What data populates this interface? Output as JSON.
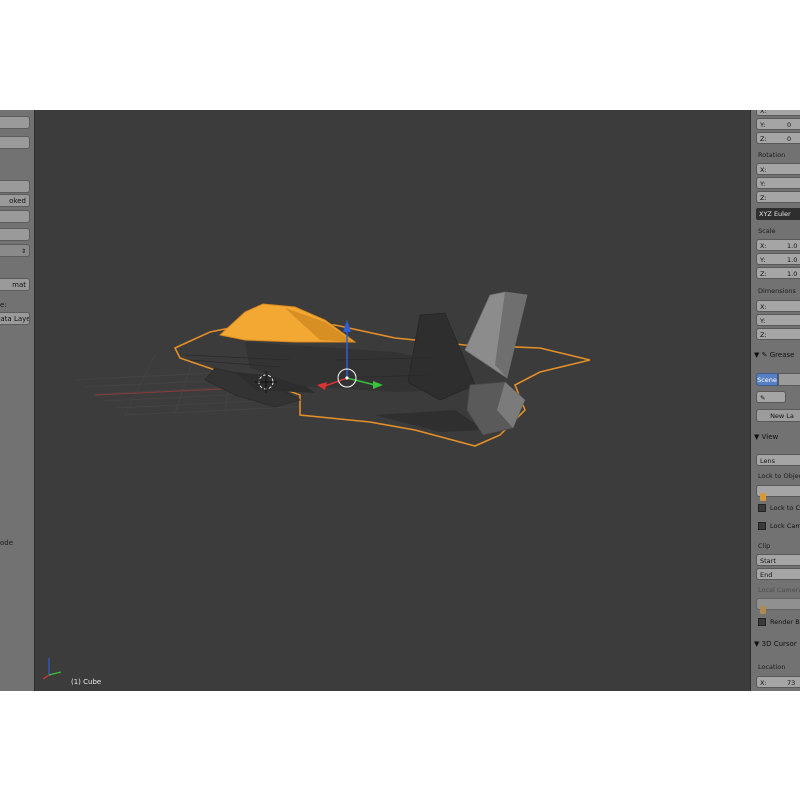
{
  "left_panel": {
    "buttons": [
      "",
      "",
      "",
      "oked",
      "",
      "",
      ""
    ],
    "labels": [
      "mat",
      "e:",
      "Data Laye"
    ],
    "text_items": [
      "ode"
    ]
  },
  "viewport": {
    "object_label": "(1) Cube",
    "colors": {
      "background": "#3c3c3c",
      "selected": "#f2a833",
      "outline": "#e38f2a",
      "axis_x": "#d83434",
      "axis_y": "#3ac23a",
      "axis_z": "#2f5ed6"
    }
  },
  "right_panel": {
    "location_fields": [
      {
        "label": "X:",
        "value": ""
      },
      {
        "label": "Y:",
        "value": "0"
      },
      {
        "label": "Z:",
        "value": "0"
      }
    ],
    "rotation_header": "Rotation",
    "rotation_fields": [
      {
        "label": "X:",
        "value": ""
      },
      {
        "label": "Y:",
        "value": ""
      },
      {
        "label": "Z:",
        "value": ""
      }
    ],
    "rotation_mode": "XYZ Euler",
    "scale_header": "Scale",
    "scale_fields": [
      {
        "label": "X:",
        "value": "1.0"
      },
      {
        "label": "Y:",
        "value": "1.0"
      },
      {
        "label": "Z:",
        "value": "1.0"
      }
    ],
    "dimensions_header": "Dimensions",
    "dimension_fields": [
      {
        "label": "X:",
        "value": ""
      },
      {
        "label": "Y:",
        "value": ""
      },
      {
        "label": "Z:",
        "value": ""
      }
    ],
    "grease_header": "Grease",
    "scene_toggle": "Scene",
    "new_layer_button": "New La",
    "view_header": "View",
    "lens_field": "Lens",
    "lock_to_object_label": "Lock to Object",
    "lock_cursor_label": "Lock to Cu",
    "lock_camera_label": "Lock Camer",
    "clip_header": "Clip",
    "clip_start_label": "Start",
    "clip_end_label": "End",
    "local_camera_label": "Local Camera",
    "render_border_label": "Render Bor",
    "cursor_header": "3D Cursor",
    "location_label": "Location",
    "cursor_x_field": {
      "label": "X:",
      "value": "73"
    }
  }
}
